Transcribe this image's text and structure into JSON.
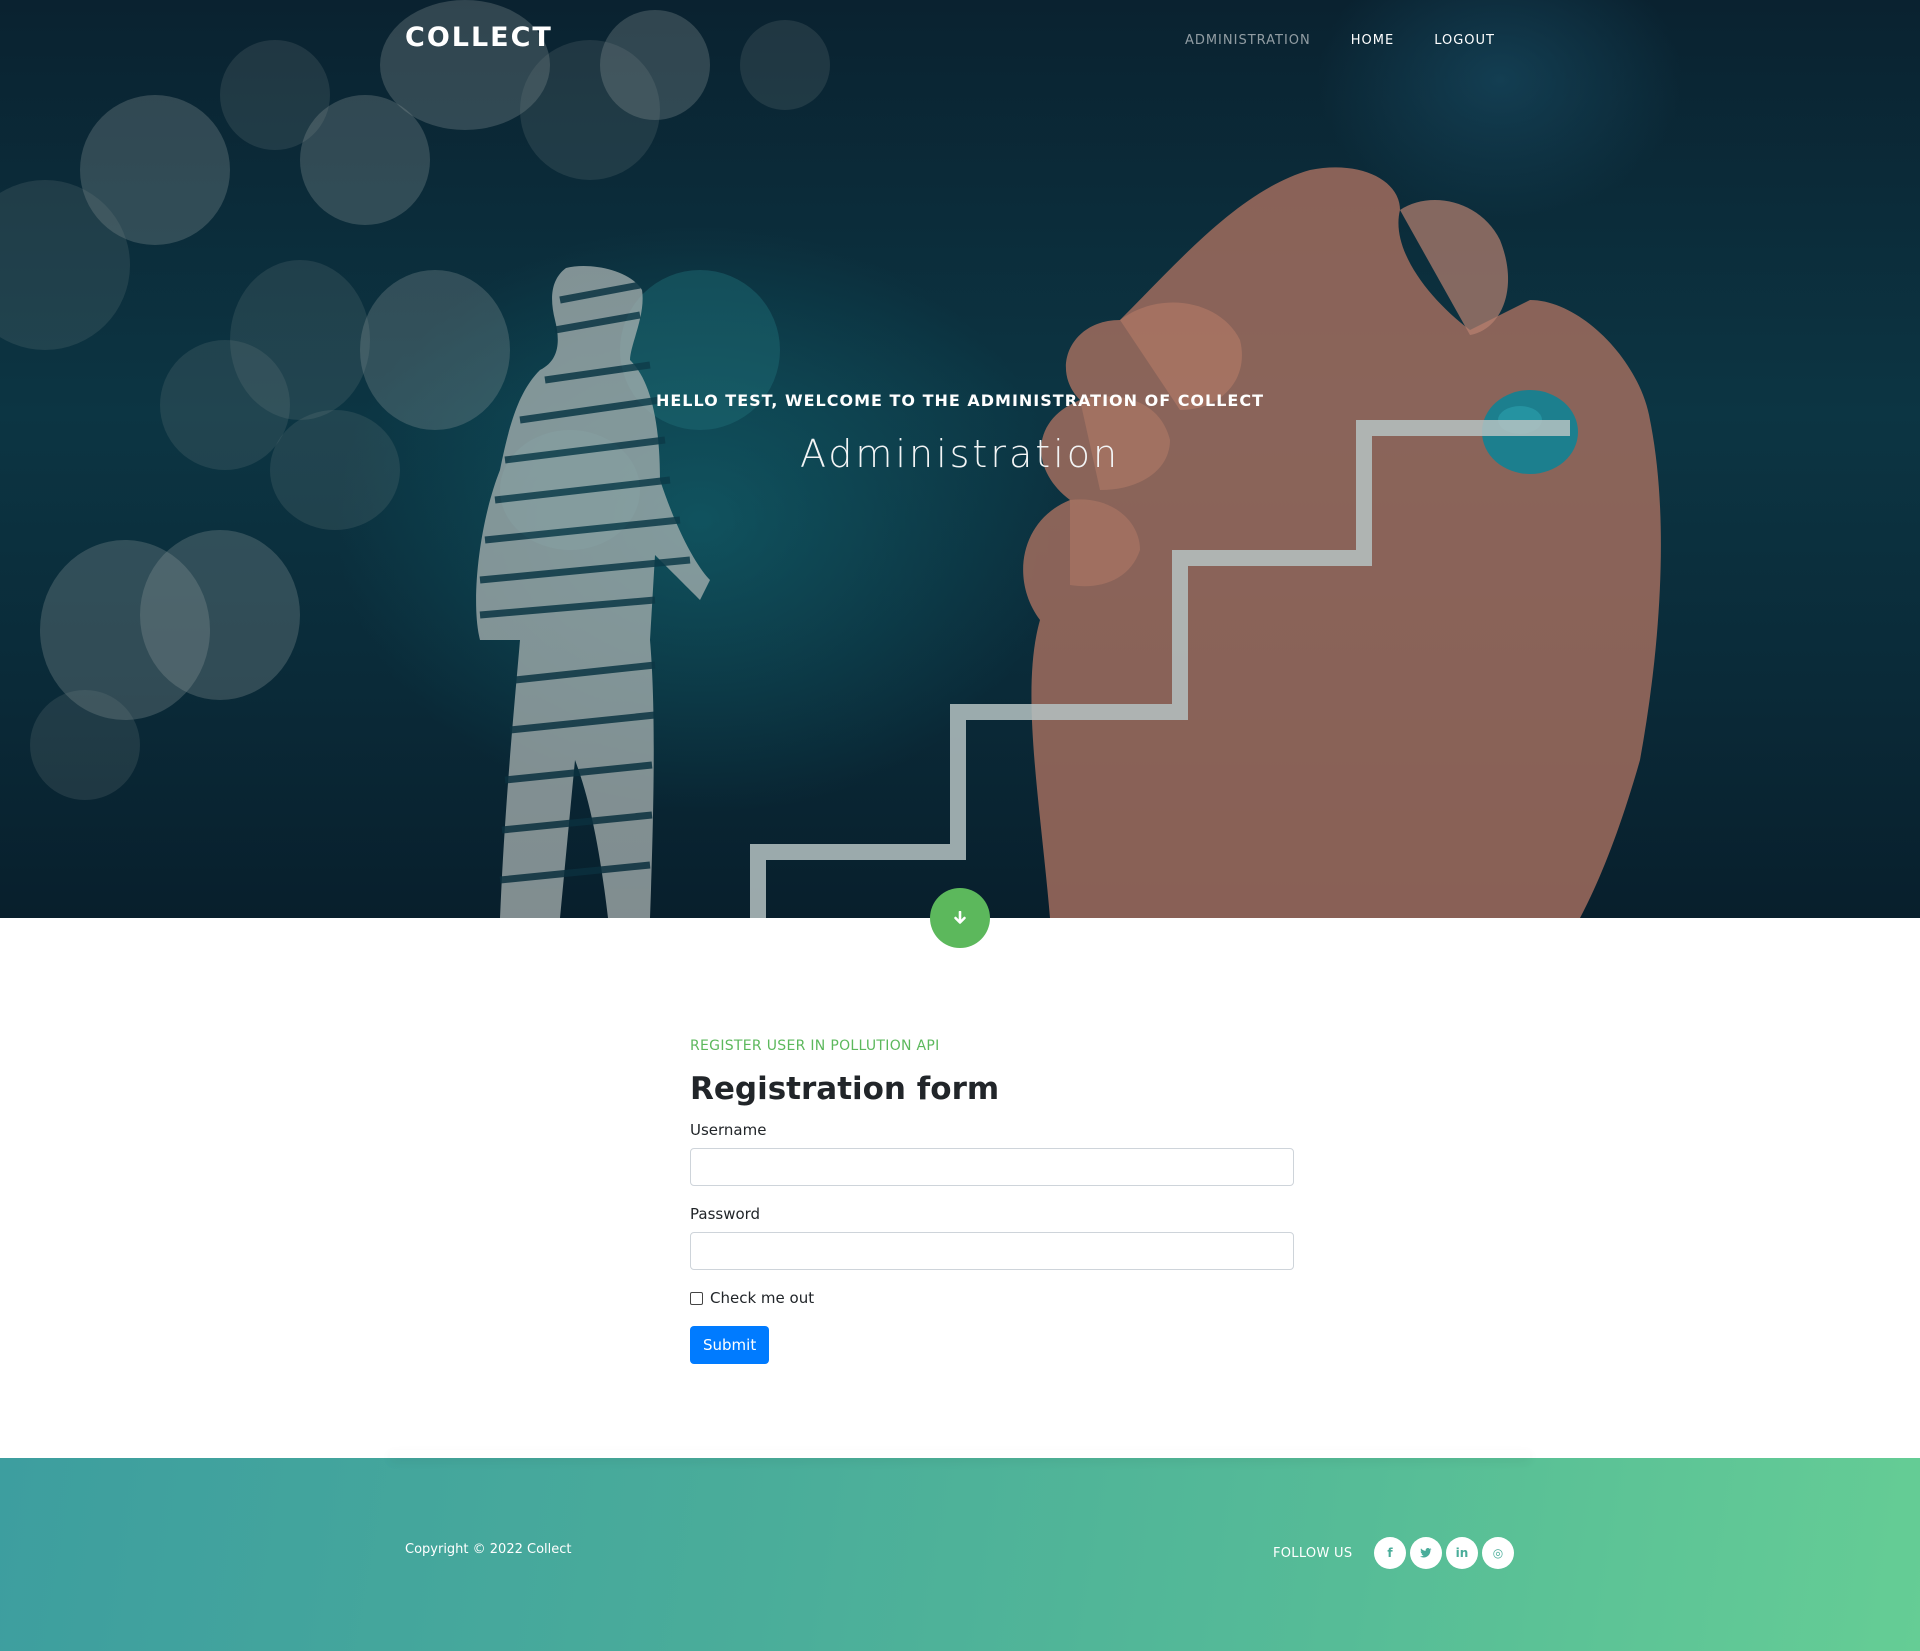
{
  "nav": {
    "brand": "COLLECT",
    "links": [
      {
        "label": "ADMINISTRATION",
        "active": true
      },
      {
        "label": "HOME",
        "active": false
      },
      {
        "label": "LOGOUT",
        "active": false
      }
    ]
  },
  "hero": {
    "subtitle": "HELLO TEST, WELCOME TO THE ADMINISTRATION OF COLLECT",
    "title": "Administration",
    "scroll_icon": "arrow-down-icon"
  },
  "form": {
    "kicker": "REGISTER USER IN POLLUTION API",
    "title": "Registration form",
    "username_label": "Username",
    "username_value": "",
    "password_label": "Password",
    "password_value": "",
    "checkbox_label": "Check me out",
    "checkbox_checked": false,
    "submit_label": "Submit"
  },
  "footer": {
    "copyright": "Copyright © 2022 Collect",
    "follow_label": "FOLLOW US",
    "socials": [
      {
        "icon": "facebook-icon",
        "glyph": "f"
      },
      {
        "icon": "twitter-icon",
        "glyph": "t"
      },
      {
        "icon": "linkedin-icon",
        "glyph": "in"
      },
      {
        "icon": "dribbble-icon",
        "glyph": "◎"
      }
    ]
  },
  "colors": {
    "accent_green": "#5cb85c",
    "primary_blue": "#007bff",
    "footer_gradient_start": "#3d9e9f",
    "footer_gradient_end": "#65cd95"
  }
}
